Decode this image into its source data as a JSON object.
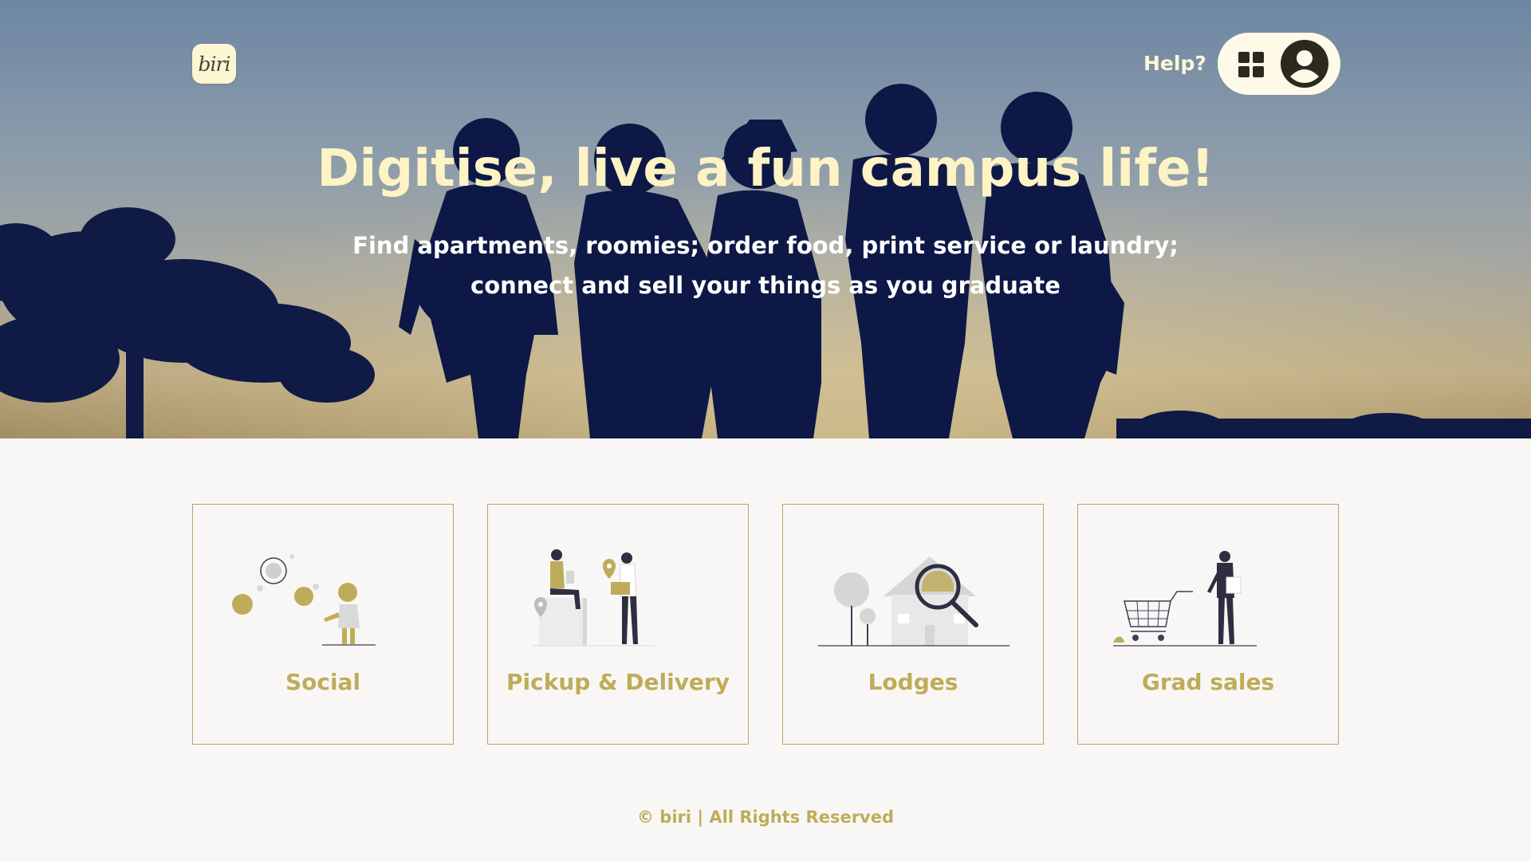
{
  "header": {
    "logo_text": "biri",
    "help_label": "Help?"
  },
  "hero": {
    "title": "Digitise, live a fun campus life!",
    "subtitle": "Find apartments, roomies; order food, print service or laundry; connect and sell your things as you graduate"
  },
  "cards": [
    {
      "label": "Social",
      "icon": "social-illustration"
    },
    {
      "label": "Pickup & Delivery",
      "icon": "delivery-illustration"
    },
    {
      "label": "Lodges",
      "icon": "house-search-illustration"
    },
    {
      "label": "Grad sales",
      "icon": "shopping-cart-illustration"
    }
  ],
  "footer": {
    "text": "© biri | All Rights Reserved"
  },
  "colors": {
    "accent": "#bfac5a",
    "cream": "#fdf3c4",
    "dark": "#2b2a1e",
    "silhouette": "#0d1846",
    "background": "#f8f7f5"
  }
}
